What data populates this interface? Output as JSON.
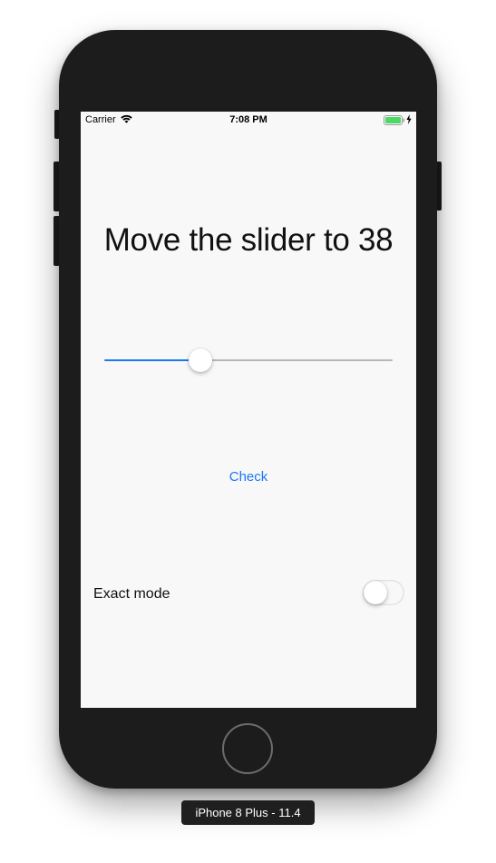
{
  "status_bar": {
    "carrier": "Carrier",
    "time": "7:08 PM",
    "wifi_icon": "wifi-icon",
    "battery_icon": "battery-full-icon",
    "charging_icon": "charging-bolt-icon",
    "battery_color": "#4cd964"
  },
  "screen": {
    "title": "Move the slider to 38",
    "slider": {
      "value": 0.318,
      "min_track_color": "#1b78f5",
      "max_track_color": "#b6b6b6"
    },
    "check_button_label": "Check",
    "exact_mode": {
      "label": "Exact mode",
      "on": false
    }
  },
  "device": {
    "caption": "iPhone 8 Plus - 11.4"
  },
  "colors": {
    "accent": "#1b78f5",
    "device_body": "#1c1c1c",
    "screen_background": "#f8f8f8"
  }
}
